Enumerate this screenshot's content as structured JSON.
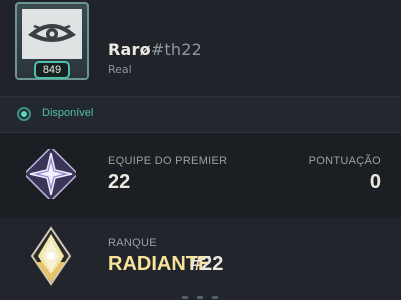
{
  "profile": {
    "level": "849",
    "name": "Rarø",
    "tag": "#th22",
    "subtitle": "Real",
    "avatar_icon": "sentinels-eye-icon"
  },
  "status": {
    "label": "Disponível",
    "color": "#4fc0ad"
  },
  "premier": {
    "team_label": "EQUIPE DO PREMIER",
    "team_value": "22",
    "score_label": "PONTUAÇÃO",
    "score_value": "0",
    "icon": "premier-star-icon"
  },
  "rank": {
    "label": "RANQUE",
    "tier": "RADIANTE",
    "position": "#22",
    "icon": "radiant-rank-icon",
    "accent": "#f7e39a"
  }
}
